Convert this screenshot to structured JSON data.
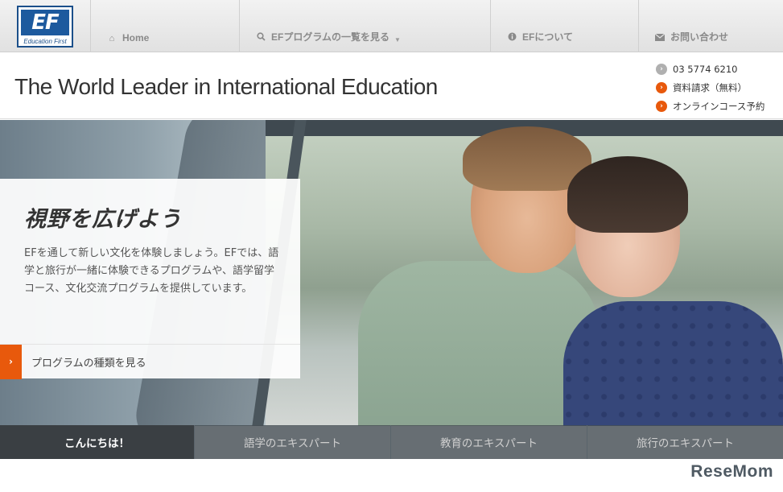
{
  "logo": {
    "mark": "EF",
    "sub": "Education First"
  },
  "nav": {
    "home": "Home",
    "programs": "EFプログラムの一覧を見る",
    "about": "EFについて",
    "contact": "お問い合わせ"
  },
  "header": {
    "tagline": "The World Leader in International Education",
    "phone": "03 5774 6210",
    "brochure": "資料請求（無料）",
    "booking": "オンラインコース予約"
  },
  "hero": {
    "title": "視野を広げよう",
    "body": "EFを通して新しい文化を体験しましょう。EFでは、語学と旅行が一緒に体験できるプログラムや、語学留学コース、文化交流プログラムを提供しています。",
    "cta": "プログラムの種類を見る"
  },
  "tabs": [
    "こんにちは！",
    "語学のエキスパート",
    "教育のエキスパート",
    "旅行のエキスパート"
  ],
  "watermark": "ReseMom",
  "colors": {
    "accent": "#e8590c",
    "brand": "#1d5a9e"
  }
}
